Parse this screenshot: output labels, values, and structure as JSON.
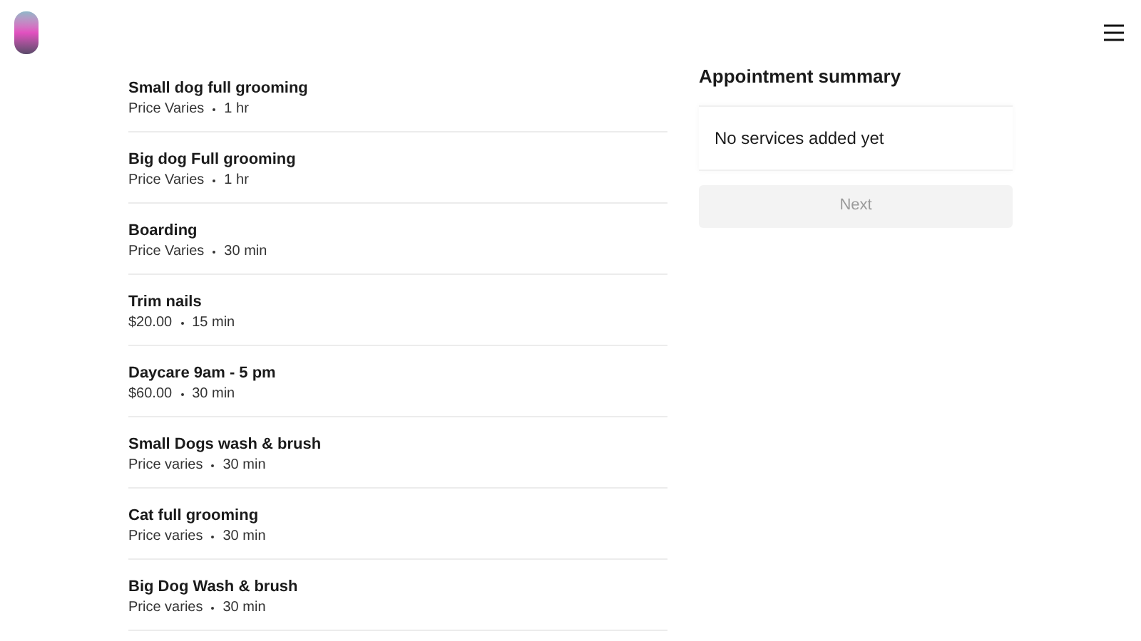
{
  "services": [
    {
      "name": "Small dog full grooming",
      "price": "Price Varies",
      "duration": "1 hr"
    },
    {
      "name": "Big dog Full grooming",
      "price": "Price Varies",
      "duration": "1 hr"
    },
    {
      "name": "Boarding",
      "price": "Price Varies",
      "duration": "30 min"
    },
    {
      "name": "Trim nails",
      "price": "$20.00",
      "duration": "15 min"
    },
    {
      "name": "Daycare 9am - 5 pm",
      "price": "$60.00",
      "duration": "30 min"
    },
    {
      "name": "Small Dogs wash & brush",
      "price": "Price varies",
      "duration": "30 min"
    },
    {
      "name": "Cat full grooming",
      "price": "Price varies",
      "duration": "30 min"
    },
    {
      "name": "Big Dog Wash & brush",
      "price": "Price varies",
      "duration": "30 min"
    }
  ],
  "summary": {
    "title": "Appointment summary",
    "empty_text": "No services added yet",
    "next_button": {
      "label": "Next",
      "disabled": true
    }
  }
}
